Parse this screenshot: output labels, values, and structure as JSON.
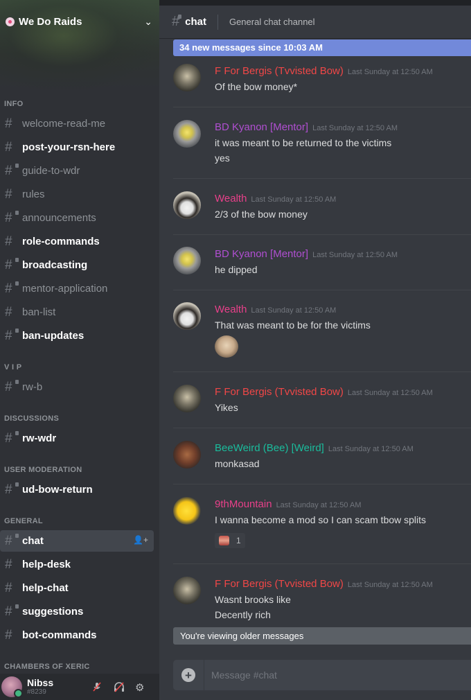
{
  "server": {
    "name": "We Do Raids",
    "chevron": "⌄"
  },
  "sidebar": {
    "categories": {
      "info": "INFO",
      "vip": "V I P",
      "discussions": "DISCUSSIONS",
      "user_moderation": "USER MODERATION",
      "general": "GENERAL",
      "chambers": "CHAMBERS OF XERIC"
    },
    "channels": {
      "welcome": "welcome-read-me",
      "post_rsn": "post-your-rsn-here",
      "guide": "guide-to-wdr",
      "rules": "rules",
      "announcements": "announcements",
      "role_commands": "role-commands",
      "broadcasting": "broadcasting",
      "mentor_application": "mentor-application",
      "ban_list": "ban-list",
      "ban_updates": "ban-updates",
      "rw_b": "rw-b",
      "rw_wdr": "rw-wdr",
      "ud_bow_return": "ud-bow-return",
      "chat": "chat",
      "help_desk": "help-desk",
      "help_chat": "help-chat",
      "suggestions": "suggestions",
      "bot_commands": "bot-commands"
    }
  },
  "user": {
    "name": "Nibss",
    "tag": "#8239"
  },
  "header": {
    "channel": "chat",
    "topic": "General chat channel"
  },
  "banners": {
    "new_messages": "34 new messages since 10:03 AM",
    "older": "You're viewing older messages"
  },
  "colors": {
    "fbergis": "#f04747",
    "kyanon": "#b04fd1",
    "wealth": "#e8408a",
    "beeweird": "#1abc9c",
    "ninth": "#e8408a"
  },
  "messages": [
    {
      "author": "F For Bergis (Tvvisted Bow)",
      "time": "Last Sunday at 12:50 AM",
      "lines": [
        "Of the bow money*"
      ]
    },
    {
      "author": "BD Kyanon [Mentor]",
      "time": "Last Sunday at 12:50 AM",
      "lines": [
        "it was meant to be returned to the victims",
        "yes"
      ]
    },
    {
      "author": "Wealth",
      "time": "Last Sunday at 12:50 AM",
      "lines": [
        "2/3 of the bow money"
      ]
    },
    {
      "author": "BD Kyanon [Mentor]",
      "time": "Last Sunday at 12:50 AM",
      "lines": [
        "he dipped"
      ]
    },
    {
      "author": "Wealth",
      "time": "Last Sunday at 12:50 AM",
      "lines": [
        "That was meant to be for the victims"
      ]
    },
    {
      "author": "F For Bergis (Tvvisted Bow)",
      "time": "Last Sunday at 12:50 AM",
      "lines": [
        "Yikes"
      ]
    },
    {
      "author": "BeeWeird (Bee) [Weird]",
      "time": "Last Sunday at 12:50 AM",
      "lines": [
        "monkasad"
      ]
    },
    {
      "author": "9thMountain",
      "time": "Last Sunday at 12:50 AM",
      "lines": [
        "I wanna become a mod so I can scam tbow splits"
      ],
      "reaction_count": "1"
    },
    {
      "author": "F For Bergis (Tvvisted Bow)",
      "time": "Last Sunday at 12:50 AM",
      "lines": [
        "Wasnt brooks like",
        "Decently rich"
      ]
    }
  ],
  "composer": {
    "placeholder": "Message #chat"
  },
  "icons": {
    "hash": "#",
    "add_member": "👤+",
    "mute": "🎙",
    "deafen": "🎧",
    "settings": "⚙",
    "attach": "+"
  }
}
